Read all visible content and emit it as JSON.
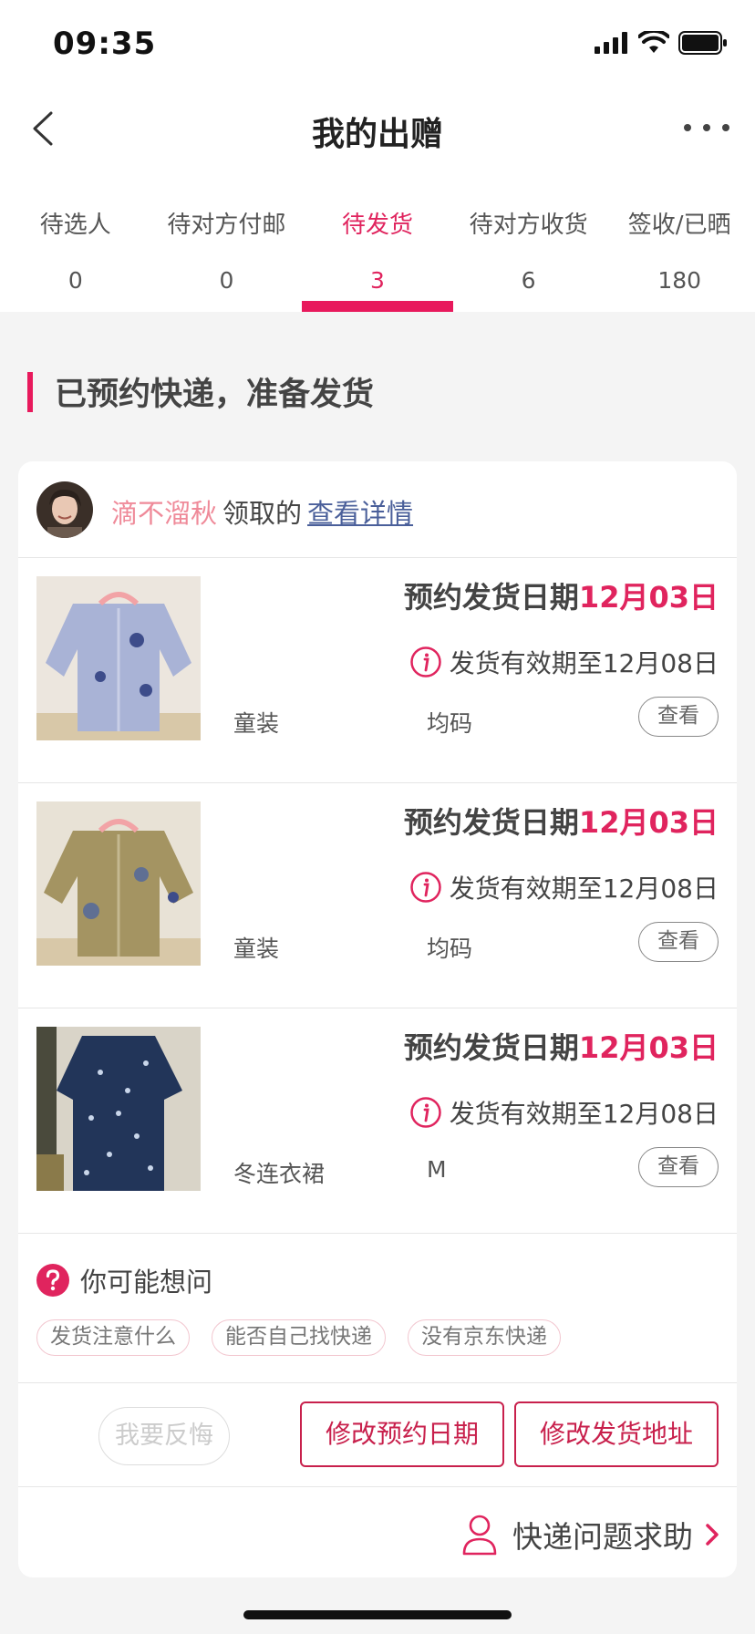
{
  "status_bar": {
    "time": "09:35"
  },
  "header": {
    "title": "我的出赠"
  },
  "tabs": [
    {
      "label": "待选人",
      "count": "0"
    },
    {
      "label": "待对方付邮",
      "count": "0"
    },
    {
      "label": "待发货",
      "count": "3",
      "active": true
    },
    {
      "label": "待对方收货",
      "count": "6"
    },
    {
      "label": "签收/已晒",
      "count": "180"
    }
  ],
  "section": {
    "title": "已预约快递，准备发货"
  },
  "claimer": {
    "name": "滴不溜秋",
    "verb": "领取的",
    "details_link": "查看详情"
  },
  "items": [
    {
      "appointment_label": "预约发货日期",
      "appointment_date": "12月03日",
      "validity": "发货有效期至12月08日",
      "category": "童装",
      "size": "均码",
      "view_label": "查看"
    },
    {
      "appointment_label": "预约发货日期",
      "appointment_date": "12月03日",
      "validity": "发货有效期至12月08日",
      "category": "童装",
      "size": "均码",
      "view_label": "查看"
    },
    {
      "appointment_label": "预约发货日期",
      "appointment_date": "12月03日",
      "validity": "发货有效期至12月08日",
      "category": "冬连衣裙",
      "size": "M",
      "view_label": "查看"
    }
  ],
  "faq": {
    "title": "你可能想问",
    "tags": [
      "发货注意什么",
      "能否自己找快递",
      "没有京东快递"
    ]
  },
  "actions": {
    "regret": "我要反悔",
    "change_date": "修改预约日期",
    "change_address": "修改发货地址"
  },
  "help": {
    "label": "快递问题求助"
  },
  "colors": {
    "accent": "#e0245e",
    "claimer_name": "#ef8a99",
    "link": "#4a5f9a"
  }
}
